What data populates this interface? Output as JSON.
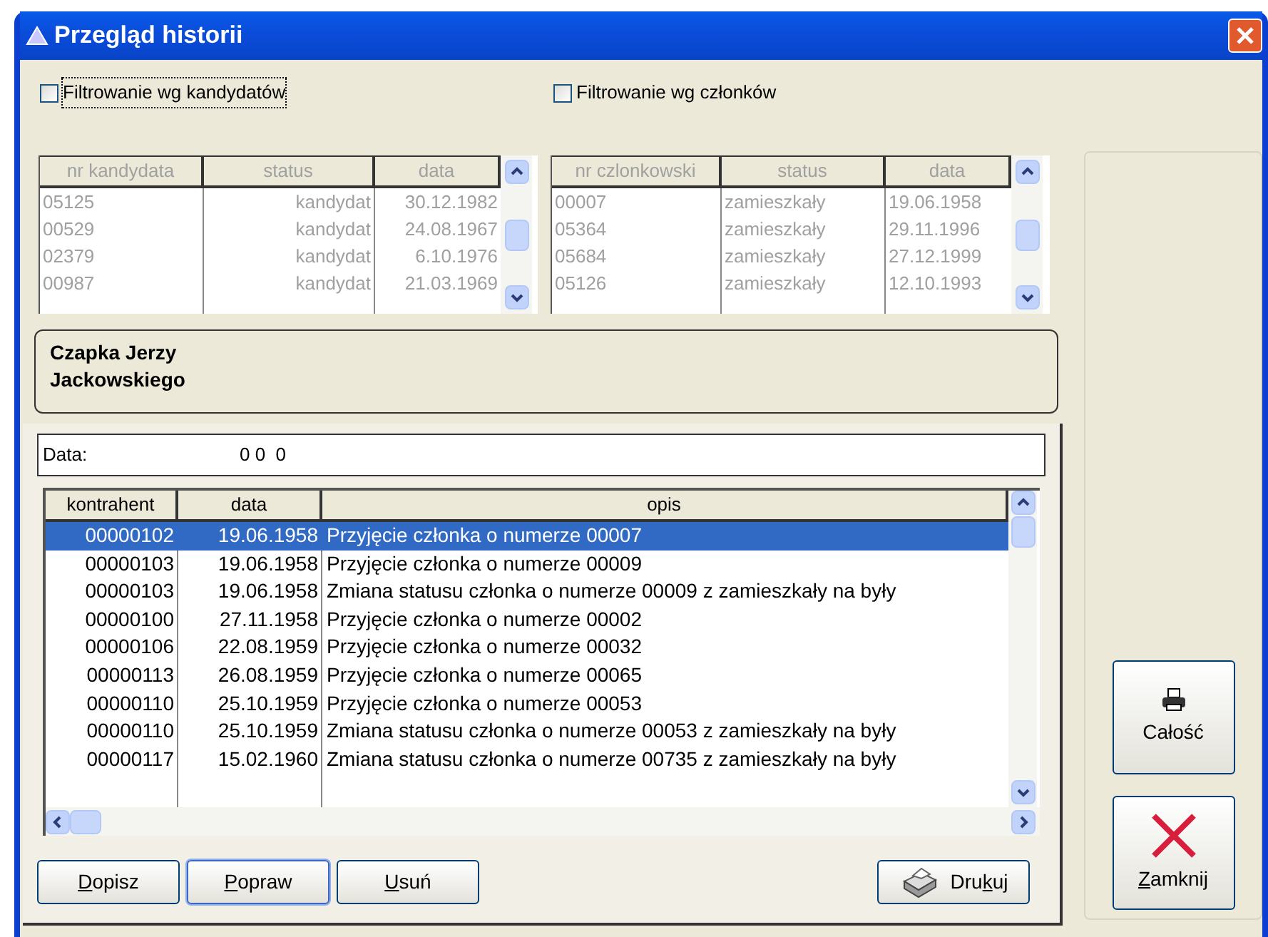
{
  "window": {
    "title": "Przegląd historii"
  },
  "filters": [
    {
      "label": "Filtrowanie wg kandydatów",
      "checked": false,
      "focused": true
    },
    {
      "label": "Filtrowanie wg członków",
      "checked": false,
      "focused": false
    }
  ],
  "tables": [
    {
      "disabled": true,
      "columns": [
        {
          "label": "nr kandydata"
        },
        {
          "label": "status"
        },
        {
          "label": "data"
        }
      ],
      "rows": [
        [
          "05125",
          "kandydat",
          "30.12.1982"
        ],
        [
          "00529",
          "kandydat",
          "24.08.1967"
        ],
        [
          "02379",
          "kandydat",
          "6.10.1976"
        ],
        [
          "00987",
          "kandydat",
          "21.03.1969"
        ]
      ]
    },
    {
      "disabled": true,
      "columns": [
        {
          "label": "nr czlonkowski"
        },
        {
          "label": "status"
        },
        {
          "label": "data"
        }
      ],
      "rows": [
        [
          "00007",
          "zamieszkały",
          "19.06.1958"
        ],
        [
          "05364",
          "zamieszkały",
          "29.11.1996"
        ],
        [
          "05684",
          "zamieszkały",
          "27.12.1999"
        ],
        [
          "05126",
          "zamieszkały",
          "12.10.1993"
        ]
      ]
    }
  ],
  "person": {
    "lines": [
      "Czapka Jerzy",
      "Jackowskiego"
    ]
  },
  "date_field": {
    "label": "Data:",
    "value": "0 0  0"
  },
  "history": {
    "columns": [
      "kontrahent",
      "data",
      "opis"
    ],
    "rows": [
      {
        "kontrahent": "00000102",
        "data": "19.06.1958",
        "opis": "Przyjęcie członka o numerze 00007",
        "selected": true
      },
      {
        "kontrahent": "00000103",
        "data": "19.06.1958",
        "opis": "Przyjęcie członka o numerze 00009",
        "selected": false
      },
      {
        "kontrahent": "00000103",
        "data": "19.06.1958",
        "opis": "Zmiana statusu członka o numerze 00009 z zamieszkały na były",
        "selected": false
      },
      {
        "kontrahent": "00000100",
        "data": "27.11.1958",
        "opis": "Przyjęcie członka o numerze 00002",
        "selected": false
      },
      {
        "kontrahent": "00000106",
        "data": "22.08.1959",
        "opis": "Przyjęcie członka o numerze 00032",
        "selected": false
      },
      {
        "kontrahent": "00000113",
        "data": "26.08.1959",
        "opis": "Przyjęcie członka o numerze 00065",
        "selected": false
      },
      {
        "kontrahent": "00000110",
        "data": "25.10.1959",
        "opis": "Przyjęcie członka o numerze 00053",
        "selected": false
      },
      {
        "kontrahent": "00000110",
        "data": "25.10.1959",
        "opis": "Zmiana statusu członka o numerze 00053 z zamieszkały na były",
        "selected": false
      },
      {
        "kontrahent": "00000117",
        "data": "15.02.1960",
        "opis": "Zmiana statusu członka o numerze 00735 z zamieszkały na były",
        "selected": false
      }
    ]
  },
  "buttons": [
    {
      "key": "D",
      "post": "opisz",
      "focused": false
    },
    {
      "key": "P",
      "post": "opraw",
      "focused": true
    },
    {
      "key": "U",
      "post": "suń",
      "focused": false
    }
  ],
  "print_button": {
    "pre": "Dru",
    "key": "k",
    "post": "uj"
  },
  "side_buttons": [
    {
      "kind": "printer",
      "pre": "Całość"
    },
    {
      "kind": "close",
      "key": "Z",
      "post": "amknij"
    }
  ]
}
